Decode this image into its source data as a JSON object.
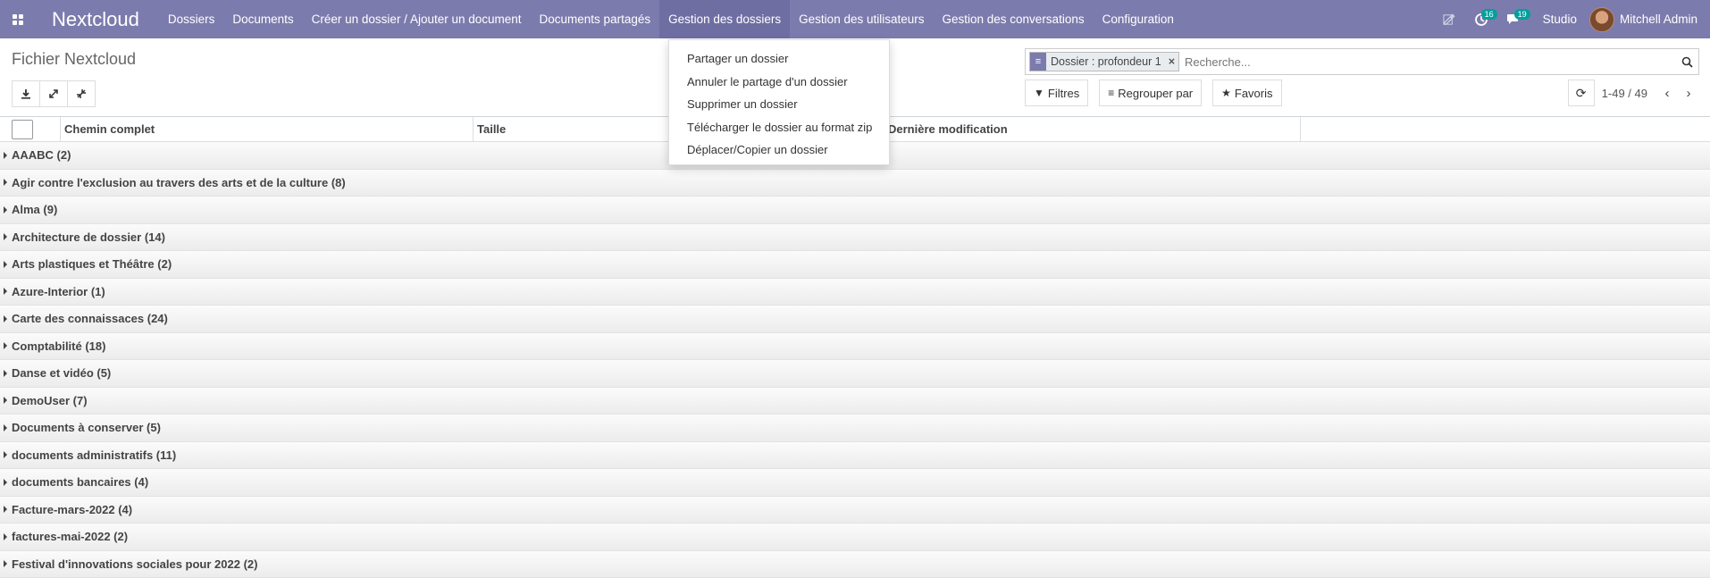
{
  "app": {
    "brand": "Nextcloud"
  },
  "nav": {
    "items": [
      {
        "label": "Dossiers",
        "active": false
      },
      {
        "label": "Documents",
        "active": false
      },
      {
        "label": "Créer un dossier / Ajouter un document",
        "active": false
      },
      {
        "label": "Documents partagés",
        "active": false
      },
      {
        "label": "Gestion des dossiers",
        "active": true
      },
      {
        "label": "Gestion des utilisateurs",
        "active": false
      },
      {
        "label": "Gestion des conversations",
        "active": false
      },
      {
        "label": "Configuration",
        "active": false
      }
    ],
    "activity_count": "16",
    "messages_count": "19",
    "studio_label": "Studio",
    "user_name": "Mitchell Admin"
  },
  "dropdown": {
    "items": [
      "Partager un dossier",
      "Annuler le partage d'un dossier",
      "Supprimer un dossier",
      "Télécharger le dossier au format zip",
      "Déplacer/Copier un dossier"
    ]
  },
  "control_panel": {
    "title": "Fichier Nextcloud",
    "facet_label": "Dossier : profondeur 1",
    "search_placeholder": "Recherche...",
    "filters_label": "Filtres",
    "groupby_label": "Regrouper par",
    "favorites_label": "Favoris",
    "pager_value": "1-49 / 49"
  },
  "table": {
    "columns": [
      "Chemin complet",
      "Taille",
      "",
      "Dernière modification"
    ],
    "groups": [
      "AAABC (2)",
      "Agir contre l'exclusion au travers des arts et de la culture (8)",
      "Alma (9)",
      "Architecture de dossier (14)",
      "Arts plastiques et Théâtre (2)",
      "Azure-Interior (1)",
      "Carte des connaissaces (24)",
      "Comptabilité (18)",
      "Danse et vidéo (5)",
      "DemoUser (7)",
      "Documents à conserver (5)",
      "documents administratifs (11)",
      "documents bancaires (4)",
      "Facture-mars-2022 (4)",
      "factures-mai-2022 (2)",
      "Festival d'innovations sociales pour 2022 (2)"
    ]
  },
  "colors": {
    "navbar": "#7c7bad",
    "badge": "#00a09d"
  }
}
